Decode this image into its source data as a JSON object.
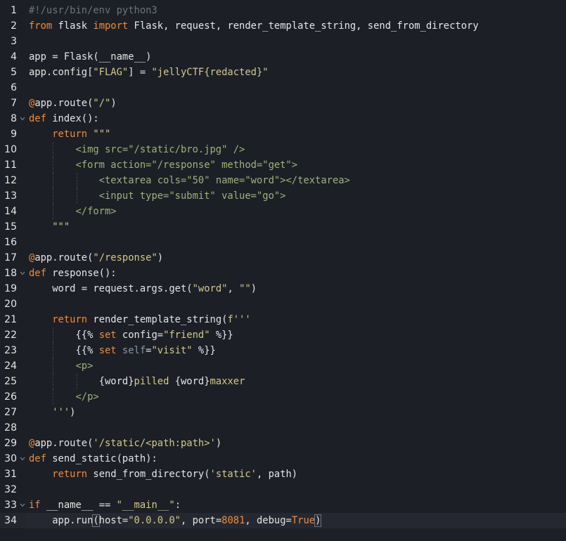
{
  "editor": {
    "lines": [
      {
        "num": "1",
        "fold": false,
        "segments": [
          {
            "c": "cmt",
            "t": "#!/usr/bin/env python3"
          }
        ]
      },
      {
        "num": "2",
        "fold": false,
        "segments": [
          {
            "c": "kw",
            "t": "from"
          },
          {
            "c": "",
            "t": " flask "
          },
          {
            "c": "kw",
            "t": "import"
          },
          {
            "c": "",
            "t": " Flask, request, render_template_string, send_from_directory"
          }
        ]
      },
      {
        "num": "3",
        "fold": false,
        "segments": []
      },
      {
        "num": "4",
        "fold": false,
        "segments": [
          {
            "c": "",
            "t": "app = Flask(__name__)"
          }
        ]
      },
      {
        "num": "5",
        "fold": false,
        "segments": [
          {
            "c": "",
            "t": "app.config["
          },
          {
            "c": "str",
            "t": "\"FLAG\""
          },
          {
            "c": "",
            "t": "] = "
          },
          {
            "c": "str",
            "t": "\"jellyCTF{redacted}\""
          }
        ]
      },
      {
        "num": "6",
        "fold": false,
        "segments": []
      },
      {
        "num": "7",
        "fold": false,
        "segments": [
          {
            "c": "kw",
            "t": "@"
          },
          {
            "c": "",
            "t": "app.route("
          },
          {
            "c": "str",
            "t": "\"/\""
          },
          {
            "c": "",
            "t": ")"
          }
        ]
      },
      {
        "num": "8",
        "fold": true,
        "segments": [
          {
            "c": "kw",
            "t": "def"
          },
          {
            "c": "",
            "t": " index():"
          }
        ]
      },
      {
        "num": "9",
        "fold": false,
        "segments": [
          {
            "c": "",
            "t": "    "
          },
          {
            "c": "kw",
            "t": "return"
          },
          {
            "c": "",
            "t": " "
          },
          {
            "c": "str",
            "t": "\"\"\""
          }
        ]
      },
      {
        "num": "10",
        "fold": false,
        "guides": 1,
        "segments": [
          {
            "c": "",
            "t": "        "
          },
          {
            "c": "tag",
            "t": "<img src=\"/static/bro.jpg\" />"
          }
        ]
      },
      {
        "num": "11",
        "fold": false,
        "guides": 1,
        "segments": [
          {
            "c": "",
            "t": "        "
          },
          {
            "c": "tag",
            "t": "<form action=\"/response\" method=\"get\">"
          }
        ]
      },
      {
        "num": "12",
        "fold": false,
        "guides": 2,
        "segments": [
          {
            "c": "",
            "t": "            "
          },
          {
            "c": "tag",
            "t": "<textarea cols=\"50\" name=\"word\"></textarea>"
          }
        ]
      },
      {
        "num": "13",
        "fold": false,
        "guides": 2,
        "segments": [
          {
            "c": "",
            "t": "            "
          },
          {
            "c": "tag",
            "t": "<input type=\"submit\" value=\"go\">"
          }
        ]
      },
      {
        "num": "14",
        "fold": false,
        "guides": 1,
        "segments": [
          {
            "c": "",
            "t": "        "
          },
          {
            "c": "tag",
            "t": "</form>"
          }
        ]
      },
      {
        "num": "15",
        "fold": false,
        "segments": [
          {
            "c": "",
            "t": "    "
          },
          {
            "c": "str",
            "t": "\"\"\""
          }
        ]
      },
      {
        "num": "16",
        "fold": false,
        "segments": []
      },
      {
        "num": "17",
        "fold": false,
        "segments": [
          {
            "c": "kw",
            "t": "@"
          },
          {
            "c": "",
            "t": "app.route("
          },
          {
            "c": "str",
            "t": "\"/response\""
          },
          {
            "c": "",
            "t": ")"
          }
        ]
      },
      {
        "num": "18",
        "fold": true,
        "segments": [
          {
            "c": "kw",
            "t": "def"
          },
          {
            "c": "",
            "t": " response():"
          }
        ]
      },
      {
        "num": "19",
        "fold": false,
        "segments": [
          {
            "c": "",
            "t": "    word = request.args.get("
          },
          {
            "c": "str",
            "t": "\"word\""
          },
          {
            "c": "",
            "t": ", "
          },
          {
            "c": "str",
            "t": "\"\""
          },
          {
            "c": "",
            "t": ")"
          }
        ]
      },
      {
        "num": "20",
        "fold": false,
        "segments": []
      },
      {
        "num": "21",
        "fold": false,
        "segments": [
          {
            "c": "",
            "t": "    "
          },
          {
            "c": "kw",
            "t": "return"
          },
          {
            "c": "",
            "t": " render_template_string("
          },
          {
            "c": "str",
            "t": "f'''"
          }
        ]
      },
      {
        "num": "22",
        "fold": false,
        "guides": 1,
        "segments": [
          {
            "c": "",
            "t": "        {{% "
          },
          {
            "c": "kw",
            "t": "set"
          },
          {
            "c": "",
            "t": " config="
          },
          {
            "c": "str",
            "t": "\"friend\""
          },
          {
            "c": "",
            "t": " %}}"
          }
        ]
      },
      {
        "num": "23",
        "fold": false,
        "guides": 1,
        "segments": [
          {
            "c": "",
            "t": "        {{% "
          },
          {
            "c": "kw",
            "t": "set"
          },
          {
            "c": "",
            "t": " "
          },
          {
            "c": "bi",
            "t": "self"
          },
          {
            "c": "",
            "t": "="
          },
          {
            "c": "str",
            "t": "\"visit\""
          },
          {
            "c": "",
            "t": " %}}"
          }
        ]
      },
      {
        "num": "24",
        "fold": false,
        "guides": 1,
        "segments": [
          {
            "c": "",
            "t": "        "
          },
          {
            "c": "tag",
            "t": "<p>"
          }
        ]
      },
      {
        "num": "25",
        "fold": false,
        "guides": 2,
        "segments": [
          {
            "c": "",
            "t": "            {word}"
          },
          {
            "c": "str",
            "t": "pilled "
          },
          {
            "c": "",
            "t": "{word}"
          },
          {
            "c": "str",
            "t": "maxxer"
          }
        ]
      },
      {
        "num": "26",
        "fold": false,
        "guides": 1,
        "segments": [
          {
            "c": "",
            "t": "        "
          },
          {
            "c": "tag",
            "t": "</p>"
          }
        ]
      },
      {
        "num": "27",
        "fold": false,
        "segments": [
          {
            "c": "",
            "t": "    "
          },
          {
            "c": "str",
            "t": "'''"
          },
          {
            "c": "",
            "t": ")"
          }
        ]
      },
      {
        "num": "28",
        "fold": false,
        "segments": []
      },
      {
        "num": "29",
        "fold": false,
        "segments": [
          {
            "c": "kw",
            "t": "@"
          },
          {
            "c": "",
            "t": "app.route("
          },
          {
            "c": "str",
            "t": "'/static/<path:path>'"
          },
          {
            "c": "",
            "t": ")"
          }
        ]
      },
      {
        "num": "30",
        "fold": true,
        "segments": [
          {
            "c": "kw",
            "t": "def"
          },
          {
            "c": "",
            "t": " send_static(path):"
          }
        ]
      },
      {
        "num": "31",
        "fold": false,
        "segments": [
          {
            "c": "",
            "t": "    "
          },
          {
            "c": "kw",
            "t": "return"
          },
          {
            "c": "",
            "t": " send_from_directory("
          },
          {
            "c": "str",
            "t": "'static'"
          },
          {
            "c": "",
            "t": ", path)"
          }
        ]
      },
      {
        "num": "32",
        "fold": false,
        "segments": []
      },
      {
        "num": "33",
        "fold": true,
        "segments": [
          {
            "c": "kw",
            "t": "if"
          },
          {
            "c": "",
            "t": " __name__ == "
          },
          {
            "c": "str",
            "t": "\"__main__\""
          },
          {
            "c": "",
            "t": ":"
          }
        ]
      },
      {
        "num": "34",
        "fold": false,
        "active": true,
        "segments": [
          {
            "c": "",
            "t": "    app.run"
          },
          {
            "c": "bracket",
            "t": "("
          },
          {
            "c": "",
            "t": "host="
          },
          {
            "c": "str",
            "t": "\"0.0.0.0\""
          },
          {
            "c": "",
            "t": ", port="
          },
          {
            "c": "num",
            "t": "8081"
          },
          {
            "c": "",
            "t": ", debug="
          },
          {
            "c": "num",
            "t": "True"
          },
          {
            "c": "bracket",
            "t": ")"
          }
        ]
      }
    ]
  },
  "colors": {
    "background": "#1c1f26",
    "text": "#e6e6e6",
    "keyword": "#f08b3b",
    "string": "#d2c98c",
    "comment": "#6d727c",
    "html_tag": "#9fb27a"
  },
  "icons": {
    "fold": "chevron-down-icon"
  }
}
